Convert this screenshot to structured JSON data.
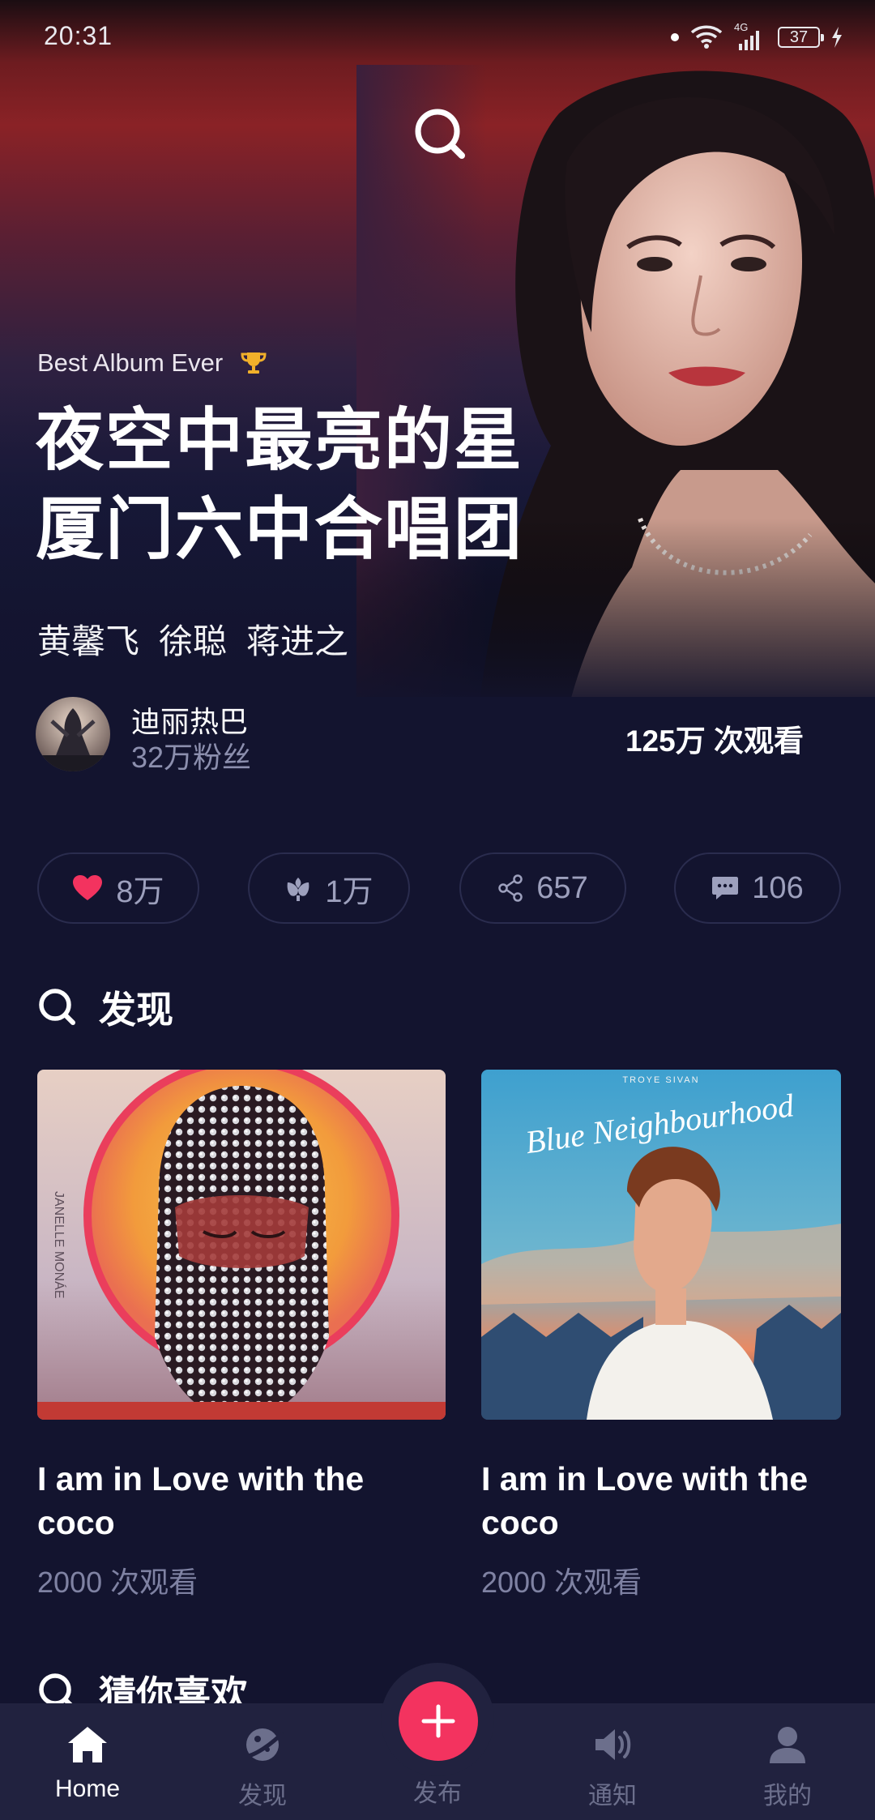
{
  "status_bar": {
    "time": "20:31",
    "network": "4G",
    "battery": "37"
  },
  "hero": {
    "kicker": "Best Album Ever",
    "title_line1": "夜空中最亮的星",
    "title_line2": "厦门六中合唱团",
    "artists": [
      "黄馨飞",
      "徐聪",
      "蒋进之"
    ]
  },
  "uploader": {
    "name": "迪丽热巴",
    "fans": "32万粉丝",
    "views": "125万 次观看"
  },
  "stats": {
    "likes": "8万",
    "gifts": "1万",
    "shares": "657",
    "comments": "106"
  },
  "discover": {
    "title": "发现",
    "cards": [
      {
        "title": "I am in Love with the coco",
        "views": "2000 次观看"
      },
      {
        "title": "I am in Love with the coco",
        "views": "2000 次观看",
        "cover_text_top": "TROYE SIVAN",
        "cover_text_script": "Blue Neighbourhood"
      }
    ]
  },
  "guess": {
    "title": "猜你喜欢"
  },
  "bottom_nav": {
    "items": [
      {
        "label": "Home",
        "icon": "home-icon",
        "active": true
      },
      {
        "label": "发现",
        "icon": "planet-icon"
      },
      {
        "label": "发布",
        "icon": "plus-icon"
      },
      {
        "label": "通知",
        "icon": "speaker-icon"
      },
      {
        "label": "我的",
        "icon": "person-icon"
      }
    ]
  },
  "colors": {
    "background": "#13142f",
    "accent": "#f3335f",
    "nav_background": "#21223f",
    "trophy": "#f1b02a",
    "muted_text": "#7f82a3"
  }
}
